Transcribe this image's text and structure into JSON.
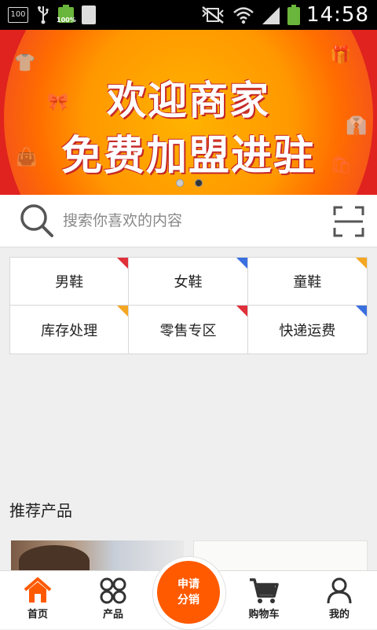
{
  "status_bar": {
    "notification_box": "100",
    "battery_small_pct": "100%",
    "time": "14:58"
  },
  "banner": {
    "line1": "欢迎商家",
    "line2": "免费加盟进驻",
    "slide_count": 2,
    "active_slide": 2
  },
  "search": {
    "placeholder": "搜索你喜欢的内容"
  },
  "categories": [
    {
      "label": "男鞋",
      "corner_color": "#e0303a"
    },
    {
      "label": "女鞋",
      "corner_color": "#3a6fe0"
    },
    {
      "label": "童鞋",
      "corner_color": "#f5a623"
    },
    {
      "label": "库存处理",
      "corner_color": "#f5a623"
    },
    {
      "label": "零售专区",
      "corner_color": "#e0303a"
    },
    {
      "label": "快递运费",
      "corner_color": "#3a6fe0"
    }
  ],
  "recommended": {
    "title": "推荐产品"
  },
  "bottom_nav": {
    "items": [
      {
        "label": "首页",
        "icon": "home-icon",
        "active": true
      },
      {
        "label": "产品",
        "icon": "grid-icon",
        "active": false
      },
      {
        "label": "购物车",
        "icon": "cart-icon",
        "active": false
      },
      {
        "label": "我的",
        "icon": "user-icon",
        "active": false
      }
    ],
    "center_button": {
      "line1": "申请",
      "line2": "分销"
    }
  },
  "colors": {
    "accent": "#ff5a00",
    "banner_red": "#e0231e"
  }
}
